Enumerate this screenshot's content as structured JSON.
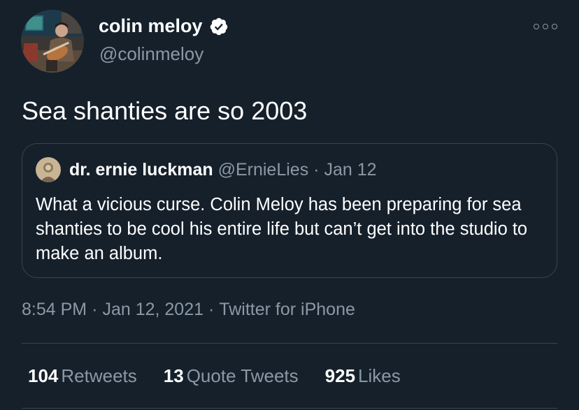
{
  "author": {
    "name": "colin meloy",
    "handle": "@colinmeloy",
    "verified": true
  },
  "tweet": {
    "text": "Sea shanties are so 2003"
  },
  "quoted_tweet": {
    "name": "dr. ernie luckman",
    "handle": "@ErnieLies",
    "date": "Jan 12",
    "separator": "·",
    "text": "What a vicious curse. Colin Meloy has been preparing for sea shanties to be cool his entire life but can’t get into the studio to make an album."
  },
  "meta": {
    "time": "8:54 PM",
    "date": "Jan 12, 2021",
    "source": "Twitter for iPhone",
    "separator": "·"
  },
  "stats": [
    {
      "count": "104",
      "label": "Retweets"
    },
    {
      "count": "13",
      "label": "Quote Tweets"
    },
    {
      "count": "925",
      "label": "Likes"
    }
  ],
  "colors": {
    "background": "#15202b",
    "secondary_text": "#8b98a5",
    "border": "#38444d"
  },
  "icons": {
    "more": "more-icon",
    "verified": "verified-badge-icon"
  }
}
